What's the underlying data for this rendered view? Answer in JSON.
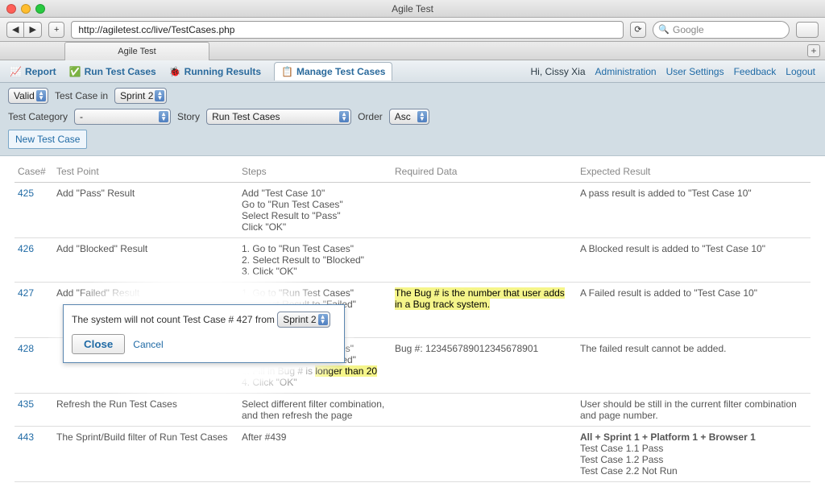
{
  "window": {
    "title": "Agile Test"
  },
  "browser": {
    "url": "http://agiletest.cc/live/TestCases.php",
    "search_placeholder": "Google",
    "tab_label": "Agile Test"
  },
  "nav": {
    "items": [
      {
        "label": "Report"
      },
      {
        "label": "Run Test Cases"
      },
      {
        "label": "Running Results"
      },
      {
        "label": "Manage Test Cases",
        "active": true
      }
    ],
    "greeting": "Hi, Cissy Xia",
    "links": [
      {
        "label": "Administration"
      },
      {
        "label": "User Settings"
      },
      {
        "label": "Feedback"
      },
      {
        "label": "Logout"
      }
    ]
  },
  "filters": {
    "validity": "Valid",
    "label_case_in": "Test Case in",
    "sprint": "Sprint 2",
    "category_label": "Test Category",
    "category_value": "-",
    "story_label": "Story",
    "story_value": "Run Test Cases",
    "order_label": "Order",
    "order_value": "Asc",
    "new_case": "New Test Case"
  },
  "table": {
    "headers": [
      "Case#",
      "Test Point",
      "Steps",
      "Required Data",
      "Expected Result"
    ],
    "rows": [
      {
        "case": "425",
        "point": "Add \"Pass\" Result",
        "steps": "Add \"Test Case 10\"\nGo to \"Run Test Cases\"\nSelect Result to \"Pass\"\nClick \"OK\"",
        "req": "",
        "exp": "A pass result is added to \"Test Case 10\""
      },
      {
        "case": "426",
        "point": "Add \"Blocked\" Result",
        "steps": "1.  Go to \"Run Test Cases\"\n2.  Select Result to \"Blocked\"\n3.  Click \"OK\"",
        "req": "",
        "exp": "A Blocked result is added to \"Test Case 10\""
      },
      {
        "case": "427",
        "point": "Add \"Failed\" Result",
        "steps": "1.  Go to \"Run Test Cases\"\n2.  Select Result to \"Failed\"\n3.  Fill in Bug #\n4.  Click \"OK\"",
        "req": "The Bug # is the number that user adds in a Bug track system.",
        "req_hl": true,
        "exp": "A Failed result is added to \"Test Case 10\""
      },
      {
        "case": "428",
        "point": "",
        "steps": "1.  Go to \"Run Test Cases\"\n2.  Select Result to \"Failed\"\n3.  Fill in Bug # is longer than 20\n4.  Click \"OK\"",
        "steps_hl": "longer than 20",
        "req": "Bug #: 123456789012345678901",
        "exp": "The failed result cannot be added."
      },
      {
        "case": "435",
        "point": "Refresh the Run Test Cases",
        "steps": "Select different filter combination, and then refresh the page",
        "req": "",
        "exp": "User should be still in the current filter combination and page number."
      },
      {
        "case": "443",
        "point": "The Sprint/Build filter of Run Test Cases",
        "steps": "After #439",
        "req": "",
        "exp": "All + Sprint 1 + Platform 1 + Browser 1\nTest Case 1.1  Pass\nTest Case 1.2  Pass\nTest Case 2.2  Not Run",
        "exp_bold_first": true
      }
    ]
  },
  "dialog": {
    "msg_prefix": "The system will not count Test Case # 427 from",
    "sprint": "Sprint 2",
    "close": "Close",
    "cancel": "Cancel"
  }
}
